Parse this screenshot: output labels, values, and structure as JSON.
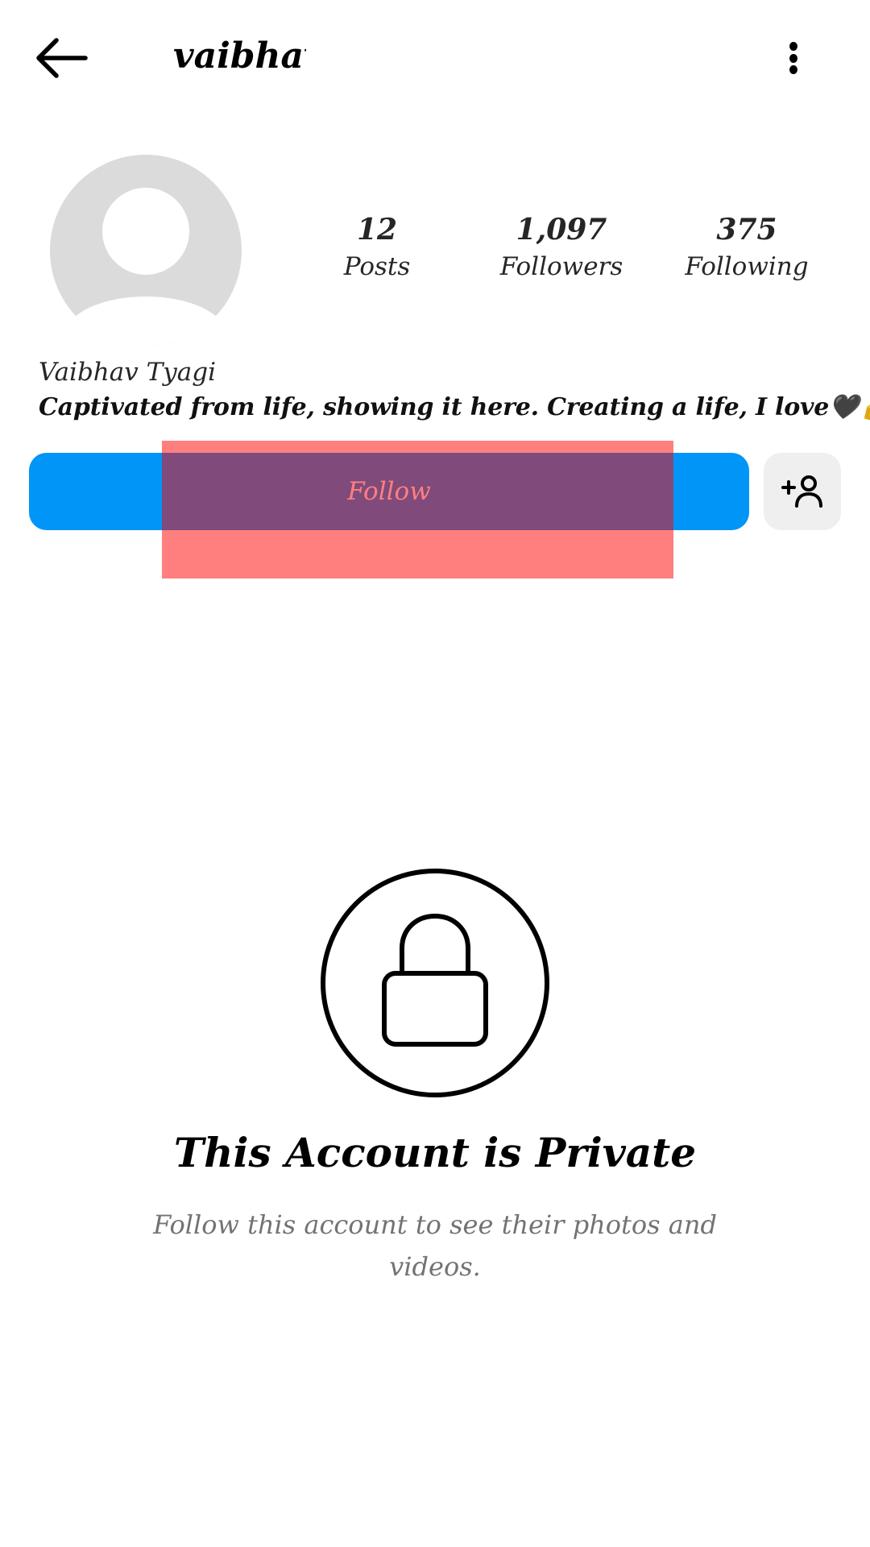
{
  "header": {
    "username": "vaibhav_",
    "back_icon": "arrow-left-icon",
    "menu_icon": "more-vertical-icon"
  },
  "profile": {
    "avatar_icon": "default-avatar-icon",
    "stats": [
      {
        "value": "12",
        "label": "Posts"
      },
      {
        "value": "1,097",
        "label": "Followers"
      },
      {
        "value": "375",
        "label": "Following"
      }
    ],
    "display_name": "Vaibhav Tyagi",
    "bio": "Captivated from life, showing it here. Creating a life, I love🖤🔓."
  },
  "actions": {
    "follow_label": "Follow",
    "add_user_icon": "add-person-icon"
  },
  "private_notice": {
    "icon": "lock-icon",
    "title": "This Account is Private",
    "subtitle": "Follow this account to see their photos and videos."
  },
  "colors": {
    "primary_blue": "#0095f6",
    "secondary_button": "#efefef",
    "avatar_gray": "#dbdbdb",
    "muted_text": "#737373",
    "highlight_overlay": "#ff0000"
  }
}
